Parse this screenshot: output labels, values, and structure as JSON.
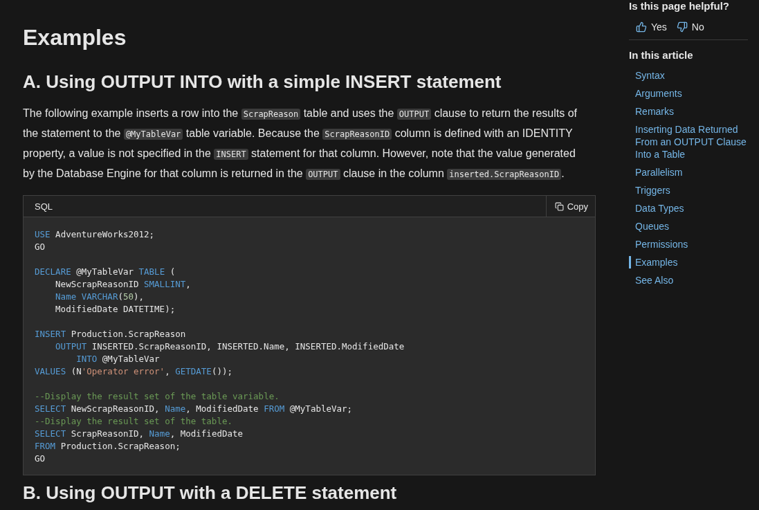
{
  "main": {
    "title": "Examples",
    "section_heading": "A. Using OUTPUT INTO with a simple INSERT statement",
    "paragraph": [
      {
        "text": "The following example inserts a row into the ",
        "code": false
      },
      {
        "text": "ScrapReason",
        "code": true
      },
      {
        "text": " table and uses the ",
        "code": false
      },
      {
        "text": "OUTPUT",
        "code": true
      },
      {
        "text": " clause to return the results of the statement to the ",
        "code": false
      },
      {
        "text": "@MyTableVar",
        "code": true
      },
      {
        "text": " table variable. Because the ",
        "code": false
      },
      {
        "text": "ScrapReasonID",
        "code": true
      },
      {
        "text": " column is defined with an IDENTITY property, a value is not specified in the ",
        "code": false
      },
      {
        "text": "INSERT",
        "code": true
      },
      {
        "text": " statement for that column. However, note that the value generated by the Database Engine for that column is returned in the ",
        "code": false
      },
      {
        "text": "OUTPUT",
        "code": true
      },
      {
        "text": " clause in the column ",
        "code": false
      },
      {
        "text": "inserted.ScrapReasonID",
        "code": true
      },
      {
        "text": ".",
        "code": false
      }
    ],
    "code_block": {
      "language": "SQL",
      "copy_label": "Copy",
      "lines": [
        {
          "kind": "flush",
          "tokens": [
            {
              "t": "USE",
              "kind": "keyword"
            },
            {
              "t": " AdventureWorks2012;",
              "kind": "plain"
            }
          ]
        },
        {
          "kind": "flush",
          "tokens": [
            {
              "t": "GO",
              "kind": "plain"
            }
          ]
        },
        {
          "kind": "blank"
        },
        {
          "kind": "flush",
          "tokens": [
            {
              "t": "DECLARE",
              "kind": "keyword"
            },
            {
              "t": " @MyTableVar ",
              "kind": "plain"
            },
            {
              "t": "TABLE",
              "kind": "keyword"
            },
            {
              "t": " (",
              "kind": "plain"
            }
          ]
        },
        {
          "kind": "indented",
          "tokens": [
            {
              "t": "NewScrapReasonID ",
              "kind": "plain"
            },
            {
              "t": "SMALLINT",
              "kind": "keyword"
            },
            {
              "t": ",",
              "kind": "plain"
            }
          ]
        },
        {
          "kind": "indented",
          "tokens": [
            {
              "t": "Name",
              "kind": "keyword"
            },
            {
              "t": " VARCHAR",
              "kind": "keyword"
            },
            {
              "t": "(",
              "kind": "plain"
            },
            {
              "t": "50",
              "kind": "number"
            },
            {
              "t": "),",
              "kind": "plain"
            }
          ]
        },
        {
          "kind": "indented",
          "tokens": [
            {
              "t": "ModifiedDate DATETIME);",
              "kind": "plain"
            }
          ]
        },
        {
          "kind": "blank"
        },
        {
          "kind": "flush",
          "tokens": [
            {
              "t": "INSERT",
              "kind": "keyword"
            },
            {
              "t": " Production.ScrapReason",
              "kind": "plain"
            }
          ]
        },
        {
          "kind": "indented",
          "tokens": [
            {
              "t": "OUTPUT",
              "kind": "keyword"
            },
            {
              "t": " INSERTED.ScrapReasonID, INSERTED.Name, INSERTED.ModifiedDate",
              "kind": "plain"
            }
          ]
        },
        {
          "kind": "deeper",
          "tokens": [
            {
              "t": "INTO",
              "kind": "keyword"
            },
            {
              "t": " @MyTableVar",
              "kind": "plain"
            }
          ]
        },
        {
          "kind": "flush",
          "tokens": [
            {
              "t": "VALUES",
              "kind": "keyword"
            },
            {
              "t": " (N",
              "kind": "plain"
            },
            {
              "t": "'Operator error'",
              "kind": "string"
            },
            {
              "t": ", ",
              "kind": "plain"
            },
            {
              "t": "GETDATE",
              "kind": "keyword"
            },
            {
              "t": "());",
              "kind": "plain"
            }
          ]
        },
        {
          "kind": "blank"
        },
        {
          "kind": "flush",
          "tokens": [
            {
              "t": "--Display the result set of the table variable.",
              "kind": "comment"
            }
          ]
        },
        {
          "kind": "flush",
          "tokens": [
            {
              "t": "SELECT",
              "kind": "keyword"
            },
            {
              "t": " NewScrapReasonID, ",
              "kind": "plain"
            },
            {
              "t": "Name",
              "kind": "keyword"
            },
            {
              "t": ", ModifiedDate ",
              "kind": "plain"
            },
            {
              "t": "FROM",
              "kind": "keyword"
            },
            {
              "t": " @MyTableVar;",
              "kind": "plain"
            }
          ]
        },
        {
          "kind": "flush",
          "tokens": [
            {
              "t": "--Display the result set of the table.",
              "kind": "comment"
            }
          ]
        },
        {
          "kind": "flush",
          "tokens": [
            {
              "t": "SELECT",
              "kind": "keyword"
            },
            {
              "t": " ScrapReasonID, ",
              "kind": "plain"
            },
            {
              "t": "Name",
              "kind": "keyword"
            },
            {
              "t": ", ModifiedDate",
              "kind": "plain"
            }
          ]
        },
        {
          "kind": "flush",
          "tokens": [
            {
              "t": "FROM",
              "kind": "keyword"
            },
            {
              "t": " Production.ScrapReason;",
              "kind": "plain"
            }
          ]
        },
        {
          "kind": "flush",
          "tokens": [
            {
              "t": "GO",
              "kind": "plain"
            }
          ]
        }
      ]
    },
    "next_heading": "B. Using OUTPUT with a DELETE statement"
  },
  "sidebar": {
    "feedback_title": "Is this page helpful?",
    "feedback_buttons": [
      {
        "label": "Yes",
        "kind": "up"
      },
      {
        "label": "No",
        "kind": "down"
      }
    ],
    "toc_title": "In this article",
    "toc": [
      {
        "label": "Syntax",
        "selected": false
      },
      {
        "label": "Arguments",
        "selected": false
      },
      {
        "label": "Remarks",
        "selected": false
      },
      {
        "label": "Inserting Data Returned From an OUTPUT Clause Into a Table",
        "selected": false
      },
      {
        "label": "Parallelism",
        "selected": false
      },
      {
        "label": "Triggers",
        "selected": false
      },
      {
        "label": "Data Types",
        "selected": false
      },
      {
        "label": "Queues",
        "selected": false
      },
      {
        "label": "Permissions",
        "selected": false
      },
      {
        "label": "Examples",
        "selected": true
      },
      {
        "label": "See Also",
        "selected": false
      }
    ]
  }
}
